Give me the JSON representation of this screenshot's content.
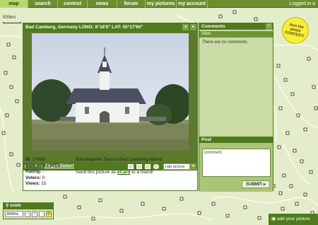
{
  "nav": {
    "tabs": [
      {
        "label": "map"
      },
      {
        "label": "search"
      },
      {
        "label": "contest"
      },
      {
        "label": "news"
      },
      {
        "label": "forum"
      },
      {
        "label": "my pictures"
      },
      {
        "label": "my account"
      }
    ],
    "login_status": "Logged in a"
  },
  "map": {
    "scale_label": "500km"
  },
  "contest_badge": {
    "text": "Join the photo CONTEST!"
  },
  "photo_window": {
    "title": "Bad Camberg, Germany  LONG: 8°16'0\" LAT: 50°17'60\"",
    "picture_by_prefix": "picture by",
    "author": "Jürgen Siebert",
    "rate_placeholder": "rate picture",
    "id_label": "Id:",
    "id_value": "27693",
    "size_label": "Size:",
    "size_value": "800 x 600",
    "rating_label": "Rating:",
    "rating_value": "-",
    "voters_label": "Voters:",
    "voters_value": "0",
    "views_label": "Views:",
    "views_value": "15",
    "description": "Kreuzkapelle Taunus Bad Camberg Abend",
    "send_prefix": "Send this picture as",
    "ecard_link": "eCard",
    "send_suffix": "to a friend!"
  },
  "comments_panel": {
    "heading": "Comments",
    "view_label": "View",
    "empty_text": "There are no comments.",
    "post_heading": "Post",
    "comment_value": "comment",
    "submit_label": "SUBMIT ▸"
  },
  "zoom": {
    "label": "zoom",
    "value": "2005%"
  },
  "footer": {
    "add_picture_label": "add your picture"
  },
  "colors": {
    "nav_bg": "#6b8f2e",
    "panel_header": "#4f7a1d",
    "map_bg": "#e4edc9",
    "badge": "#f5ef3a"
  }
}
